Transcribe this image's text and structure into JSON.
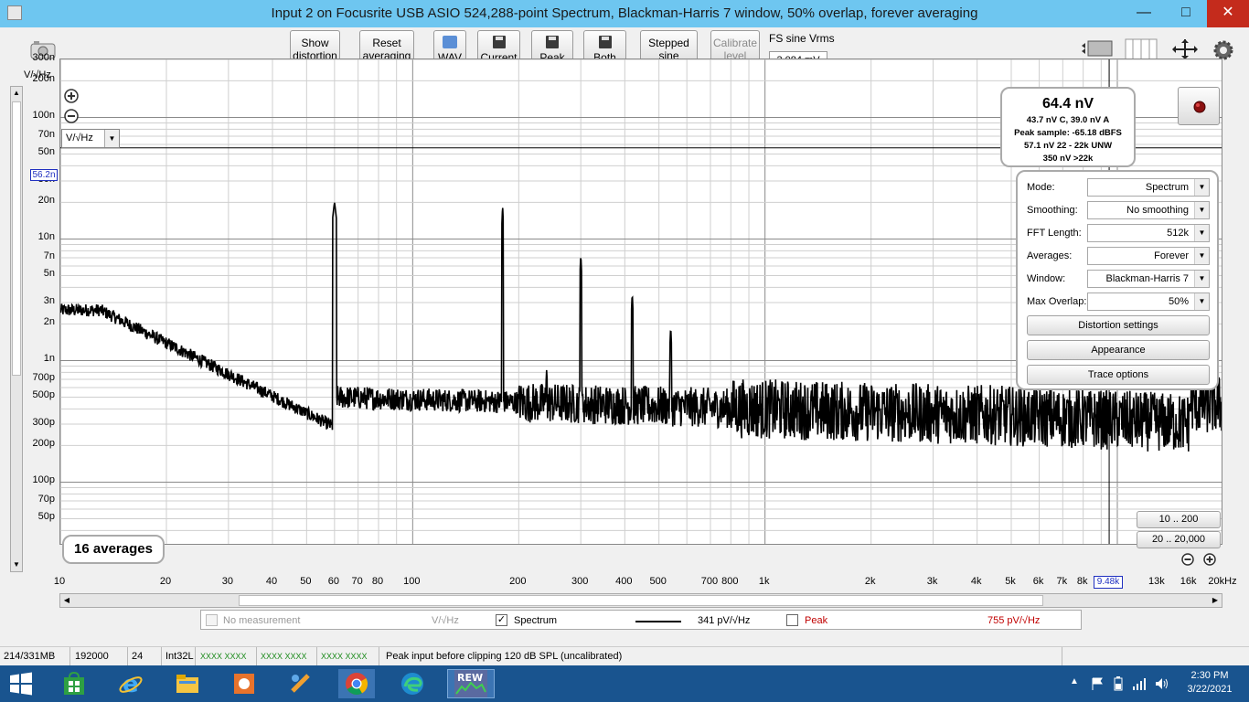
{
  "window": {
    "title": "Input 2 on Focusrite USB ASIO 524,288-point Spectrum, Blackman-Harris 7 window, 50% overlap, forever averaging",
    "minimize": "—",
    "maximize": "□",
    "close": "✕"
  },
  "toolbar": {
    "show_distortion": "Show distortion",
    "reset_averaging": "Reset averaging",
    "wav": "WAV",
    "current": "Current",
    "peak": "Peak",
    "both": "Both",
    "stepped_sine": "Stepped sine",
    "calibrate_level": "Calibrate level",
    "fs_label": "FS sine Vrms",
    "fs_value": "3.084 mV"
  },
  "graph": {
    "y_unit": "V/√Hz",
    "y_ticks": [
      "300n",
      "200n",
      "100n",
      "70n",
      "50n",
      "30n",
      "20n",
      "10n",
      "7n",
      "5n",
      "3n",
      "2n",
      "1n",
      "700p",
      "500p",
      "300p",
      "200p",
      "100p",
      "70p",
      "50p"
    ],
    "x_ticks": [
      "10",
      "20",
      "30",
      "40",
      "50",
      "60",
      "70",
      "80",
      "100",
      "200",
      "300",
      "400",
      "500",
      "700",
      "800",
      "1k",
      "2k",
      "3k",
      "4k",
      "5k",
      "6k",
      "7k",
      "8k",
      "13k",
      "16k",
      "20kHz"
    ],
    "y_marker": "56.2n",
    "x_marker": "9.48k",
    "unit_select": "V/√Hz",
    "averages": "16 averages",
    "range_10_200": "10 .. 200",
    "range_20_20000": "20 .. 20,000"
  },
  "readout": {
    "main": "64.4 nV",
    "line1": "43.7 nV C, 39.0 nV A",
    "line2": "Peak sample: -65.18 dBFS",
    "line3": "57.1 nV 22 - 22k UNW",
    "line4": "350 nV >22k"
  },
  "settings": {
    "mode_label": "Mode:",
    "mode_value": "Spectrum",
    "smoothing_label": "Smoothing:",
    "smoothing_value": "No  smoothing",
    "fft_label": "FFT Length:",
    "fft_value": "512k",
    "averages_label": "Averages:",
    "averages_value": "Forever",
    "window_label": "Window:",
    "window_value": "Blackman-Harris 7",
    "overlap_label": "Max Overlap:",
    "overlap_value": "50%",
    "distortion_settings": "Distortion settings",
    "appearance": "Appearance",
    "trace_options": "Trace options"
  },
  "legend": {
    "no_measurement": "No measurement",
    "no_measurement_unit": "V/√Hz",
    "spectrum": "Spectrum",
    "spectrum_value": "341 pV/√Hz",
    "peak": "Peak",
    "peak_value": "755 pV/√Hz"
  },
  "statusbar": {
    "memory": "214/331MB",
    "rate": "192000 Hz",
    "bits": "24 Bit",
    "format": "Int32L",
    "meters": "XXXX XXXX",
    "message": "Peak input before clipping 120 dB SPL (uncalibrated)"
  },
  "tray": {
    "time": "2:30 PM",
    "date": "3/22/2021"
  },
  "colors": {
    "titlebar": "#6ec6f0",
    "taskbar": "#19548f",
    "trace": "#000000",
    "peak_text": "#c00000"
  }
}
